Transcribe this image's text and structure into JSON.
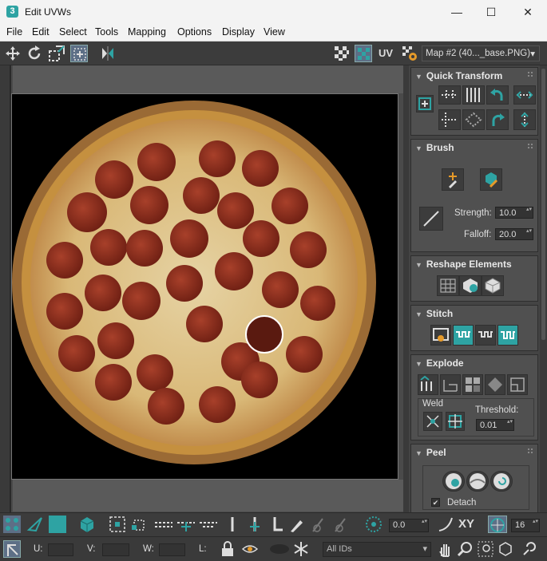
{
  "window": {
    "title": "Edit UVWs",
    "app_icon": "3",
    "minimize": "—",
    "maximize": "☐",
    "close": "✕"
  },
  "menu": [
    "File",
    "Edit",
    "Select",
    "Tools",
    "Mapping",
    "Options",
    "Display",
    "View"
  ],
  "toolbar": {
    "uv_label": "UV",
    "map_select": "Map #2 (40..._base.PNG)",
    "map_caret": "▾"
  },
  "panel": {
    "quick_transform": {
      "title": "Quick Transform"
    },
    "brush": {
      "title": "Brush",
      "strength_label": "Strength:",
      "strength_value": "10.0",
      "falloff_label": "Falloff:",
      "falloff_value": "20.0"
    },
    "reshape": {
      "title": "Reshape Elements"
    },
    "stitch": {
      "title": "Stitch"
    },
    "explode": {
      "title": "Explode",
      "weld_label": "Weld",
      "threshold_label": "Threshold:",
      "threshold_value": "0.01"
    },
    "peel": {
      "title": "Peel",
      "detach_label": "Detach",
      "detach_checked": true
    }
  },
  "bottom": {
    "angle_value": "0.0",
    "xy_label": "XY",
    "grid_value": "16",
    "u_label": "U:",
    "v_label": "V:",
    "w_label": "W:",
    "l_label": "L:",
    "ids_select": "All IDs",
    "u_value": "",
    "v_value": "",
    "w_value": ""
  },
  "colors": {
    "accent": "#2ea3a3",
    "panel": "#505050",
    "background": "#444444"
  }
}
